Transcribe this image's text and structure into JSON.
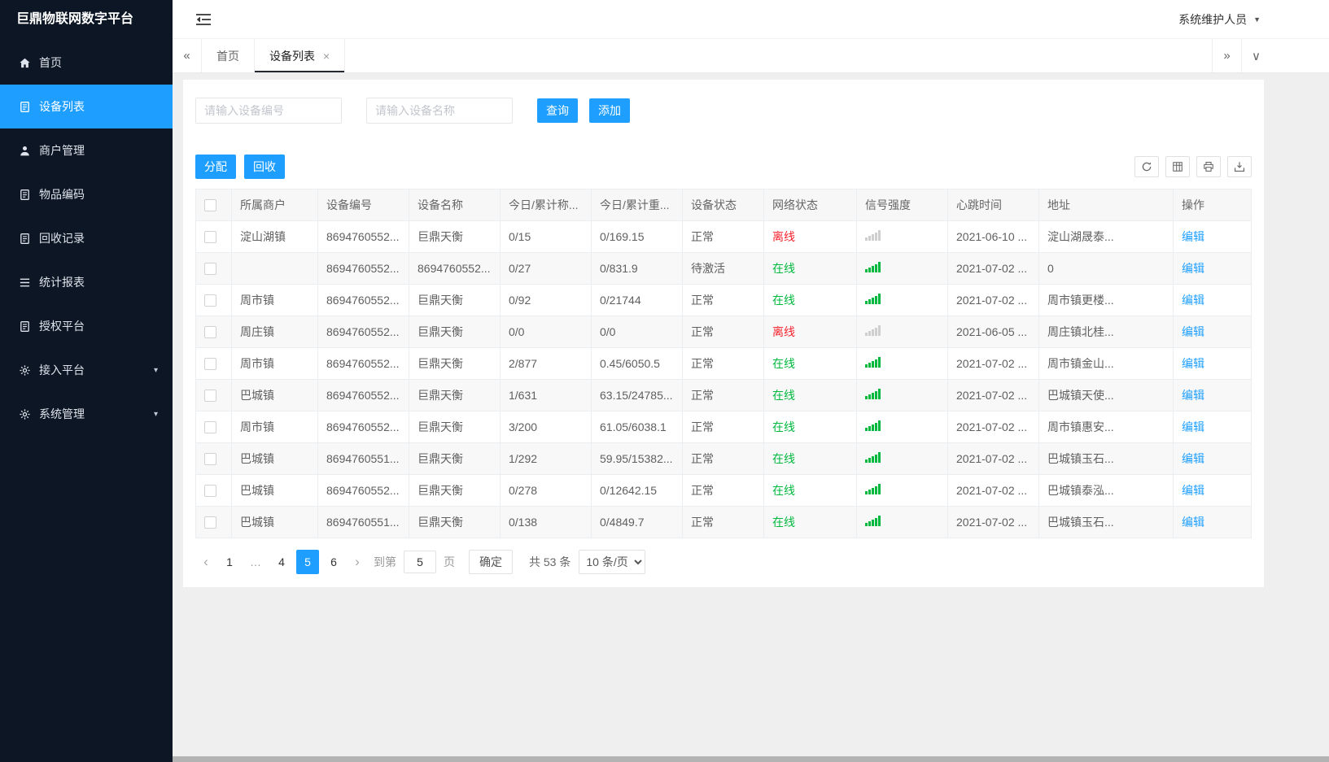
{
  "colors": {
    "primary": "#1e9fff",
    "sidebar_bg": "#0c1624",
    "online_green": "#00b83e",
    "offline_red": "#f5222d",
    "content_bg": "#efefef"
  },
  "app": {
    "title": "巨鼎物联网数字平台",
    "user_name": "系统维护人员"
  },
  "sidebar": {
    "items": [
      {
        "id": "home",
        "label": "首页",
        "icon": "home-icon",
        "active": false,
        "expandable": false
      },
      {
        "id": "device-list",
        "label": "设备列表",
        "icon": "doc-icon",
        "active": true,
        "expandable": false
      },
      {
        "id": "merchant-mgmt",
        "label": "商户管理",
        "icon": "user-icon",
        "active": false,
        "expandable": false
      },
      {
        "id": "item-code",
        "label": "物品编码",
        "icon": "doc-icon",
        "active": false,
        "expandable": false
      },
      {
        "id": "recycle-record",
        "label": "回收记录",
        "icon": "doc-icon",
        "active": false,
        "expandable": false
      },
      {
        "id": "stats-report",
        "label": "统计报表",
        "icon": "list-icon",
        "active": false,
        "expandable": false
      },
      {
        "id": "auth-platform",
        "label": "授权平台",
        "icon": "doc-icon",
        "active": false,
        "expandable": false
      },
      {
        "id": "access-platform",
        "label": "接入平台",
        "icon": "gear-icon",
        "active": false,
        "expandable": true
      },
      {
        "id": "system-mgmt",
        "label": "系统管理",
        "icon": "gear-icon",
        "active": false,
        "expandable": true
      }
    ]
  },
  "tabs": [
    {
      "id": "home",
      "label": "首页",
      "active": false,
      "closable": false
    },
    {
      "id": "device-list",
      "label": "设备列表",
      "active": true,
      "closable": true
    }
  ],
  "search": {
    "device_no_placeholder": "请输入设备编号",
    "device_name_placeholder": "请输入设备名称",
    "query_label": "查询",
    "add_label": "添加"
  },
  "toolbar": {
    "assign_label": "分配",
    "recycle_label": "回收",
    "icon_buttons": [
      "refresh-icon",
      "columns-icon",
      "print-icon",
      "export-icon"
    ]
  },
  "table": {
    "headers": [
      "所属商户",
      "设备编号",
      "设备名称",
      "今日/累计称...",
      "今日/累计重...",
      "设备状态",
      "网络状态",
      "信号强度",
      "心跳时间",
      "地址",
      "操作"
    ],
    "edit_label": "编辑",
    "rows": [
      {
        "merchant": "淀山湖镇",
        "device_no": "8694760552...",
        "device_name": "巨鼎天衡",
        "today_count": "0/15",
        "today_weight": "0/169.15",
        "device_status": "正常",
        "network_status": "离线",
        "online": false,
        "signal": "weak",
        "heartbeat": "2021-06-10 ...",
        "address": "淀山湖晟泰..."
      },
      {
        "merchant": "",
        "device_no": "8694760552...",
        "device_name": "8694760552...",
        "today_count": "0/27",
        "today_weight": "0/831.9",
        "device_status": "待激活",
        "network_status": "在线",
        "online": true,
        "signal": "strong",
        "heartbeat": "2021-07-02 ...",
        "address": "0"
      },
      {
        "merchant": "周市镇",
        "device_no": "8694760552...",
        "device_name": "巨鼎天衡",
        "today_count": "0/92",
        "today_weight": "0/21744",
        "device_status": "正常",
        "network_status": "在线",
        "online": true,
        "signal": "strong",
        "heartbeat": "2021-07-02 ...",
        "address": "周市镇更楼..."
      },
      {
        "merchant": "周庄镇",
        "device_no": "8694760552...",
        "device_name": "巨鼎天衡",
        "today_count": "0/0",
        "today_weight": "0/0",
        "device_status": "正常",
        "network_status": "离线",
        "online": false,
        "signal": "weak",
        "heartbeat": "2021-06-05 ...",
        "address": "周庄镇北桂..."
      },
      {
        "merchant": "周市镇",
        "device_no": "8694760552...",
        "device_name": "巨鼎天衡",
        "today_count": "2/877",
        "today_weight": "0.45/6050.5",
        "device_status": "正常",
        "network_status": "在线",
        "online": true,
        "signal": "strong",
        "heartbeat": "2021-07-02 ...",
        "address": "周市镇金山..."
      },
      {
        "merchant": "巴城镇",
        "device_no": "8694760552...",
        "device_name": "巨鼎天衡",
        "today_count": "1/631",
        "today_weight": "63.15/24785...",
        "device_status": "正常",
        "network_status": "在线",
        "online": true,
        "signal": "strong",
        "heartbeat": "2021-07-02 ...",
        "address": "巴城镇天使..."
      },
      {
        "merchant": "周市镇",
        "device_no": "8694760552...",
        "device_name": "巨鼎天衡",
        "today_count": "3/200",
        "today_weight": "61.05/6038.1",
        "device_status": "正常",
        "network_status": "在线",
        "online": true,
        "signal": "strong",
        "heartbeat": "2021-07-02 ...",
        "address": "周市镇惠安..."
      },
      {
        "merchant": "巴城镇",
        "device_no": "8694760551...",
        "device_name": "巨鼎天衡",
        "today_count": "1/292",
        "today_weight": "59.95/15382...",
        "device_status": "正常",
        "network_status": "在线",
        "online": true,
        "signal": "strong",
        "heartbeat": "2021-07-02 ...",
        "address": "巴城镇玉石..."
      },
      {
        "merchant": "巴城镇",
        "device_no": "8694760552...",
        "device_name": "巨鼎天衡",
        "today_count": "0/278",
        "today_weight": "0/12642.15",
        "device_status": "正常",
        "network_status": "在线",
        "online": true,
        "signal": "strong",
        "heartbeat": "2021-07-02 ...",
        "address": "巴城镇泰泓..."
      },
      {
        "merchant": "巴城镇",
        "device_no": "8694760551...",
        "device_name": "巨鼎天衡",
        "today_count": "0/138",
        "today_weight": "0/4849.7",
        "device_status": "正常",
        "network_status": "在线",
        "online": true,
        "signal": "strong",
        "heartbeat": "2021-07-02 ...",
        "address": "巴城镇玉石..."
      }
    ]
  },
  "pagination": {
    "pages": [
      "1",
      "...",
      "4",
      "5",
      "6"
    ],
    "active_page": "5",
    "goto_label": "到第",
    "goto_value": "5",
    "page_unit": "页",
    "confirm_label": "确定",
    "total_text": "共 53 条",
    "page_size": "10 条/页"
  }
}
